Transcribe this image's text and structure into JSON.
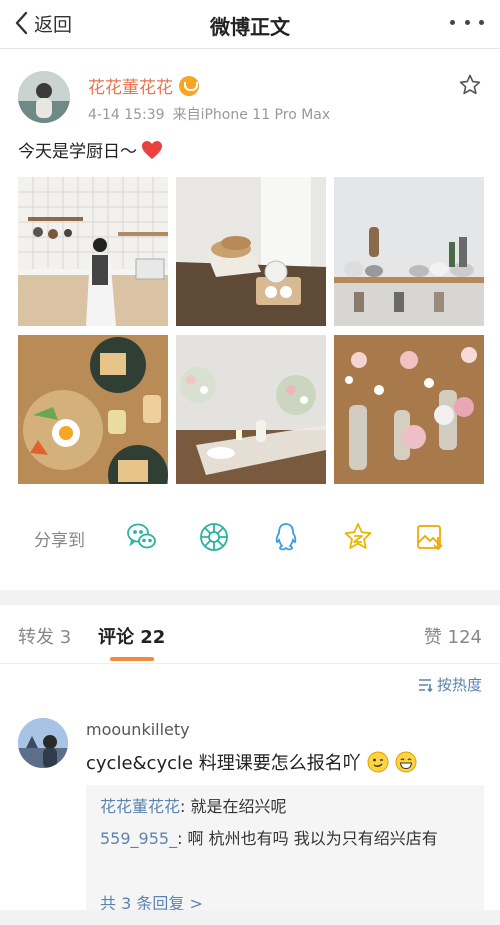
{
  "nav": {
    "back_label": "返回",
    "title": "微博正文"
  },
  "post": {
    "username": "花花董花花",
    "time": "4-14 15:39",
    "source": "来自iPhone 11 Pro Max",
    "text": "今天是学厨日～"
  },
  "share": {
    "label": "分享到",
    "icons": [
      "wechat-icon",
      "moments-icon",
      "qq-icon",
      "qzone-icon",
      "save-image-icon"
    ]
  },
  "tabs": {
    "repost_label": "转发",
    "repost_count": "3",
    "comment_label": "评论",
    "comment_count": "22",
    "like_label": "赞",
    "like_count": "124"
  },
  "sort_label": "按热度",
  "comment": {
    "username": "moounkillety",
    "text": "cycle&cycle 料理课要怎么报名吖",
    "replies": [
      {
        "name": "花花董花花",
        "text": ": 就是在绍兴呢"
      },
      {
        "name": "559_955_",
        "text": ": 啊 杭州也有吗 我以为只有绍兴店有"
      }
    ],
    "more_replies": "共 3 条回复 >"
  },
  "colors": {
    "accent": "#eb7350",
    "link": "#5b84b0",
    "tab_indicator": "#f08a3e",
    "share_icon": "#2bb3a0"
  }
}
